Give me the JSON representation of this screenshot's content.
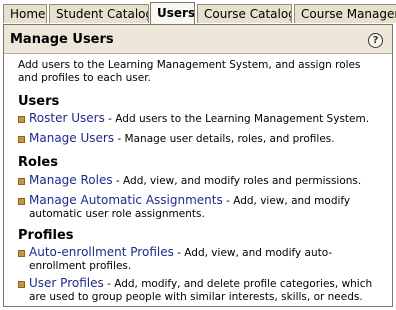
{
  "tabs": [
    {
      "label": "Home"
    },
    {
      "label": "Student Catalog"
    },
    {
      "label": "Users"
    },
    {
      "label": "Course Catalog"
    },
    {
      "label": "Course Manageme"
    }
  ],
  "panel": {
    "title": "Manage Users",
    "help": "?",
    "intro": "Add users to the Learning Management System, and assign roles and profiles to each user."
  },
  "sections": {
    "users": {
      "heading": "Users",
      "items": [
        {
          "link": "Roster Users",
          "desc": " - Add users to the Learning Management System."
        },
        {
          "link": "Manage Users",
          "desc": " - Manage user details, roles, and profiles."
        }
      ]
    },
    "roles": {
      "heading": "Roles",
      "items": [
        {
          "link": "Manage Roles",
          "desc": " - Add, view, and modify roles and permissions."
        },
        {
          "link": "Manage Automatic Assignments",
          "desc": " - Add, view, and modify automatic user role assignments."
        }
      ]
    },
    "profiles": {
      "heading": "Profiles",
      "items": [
        {
          "link": "Auto-enrollment Profiles",
          "desc": " - Add, view, and modify auto-enrollment profiles."
        },
        {
          "link": "User Profiles",
          "desc": " - Add, modify, and delete profile categories, which are used to group people with similar interests, skills, or needs."
        }
      ]
    }
  }
}
